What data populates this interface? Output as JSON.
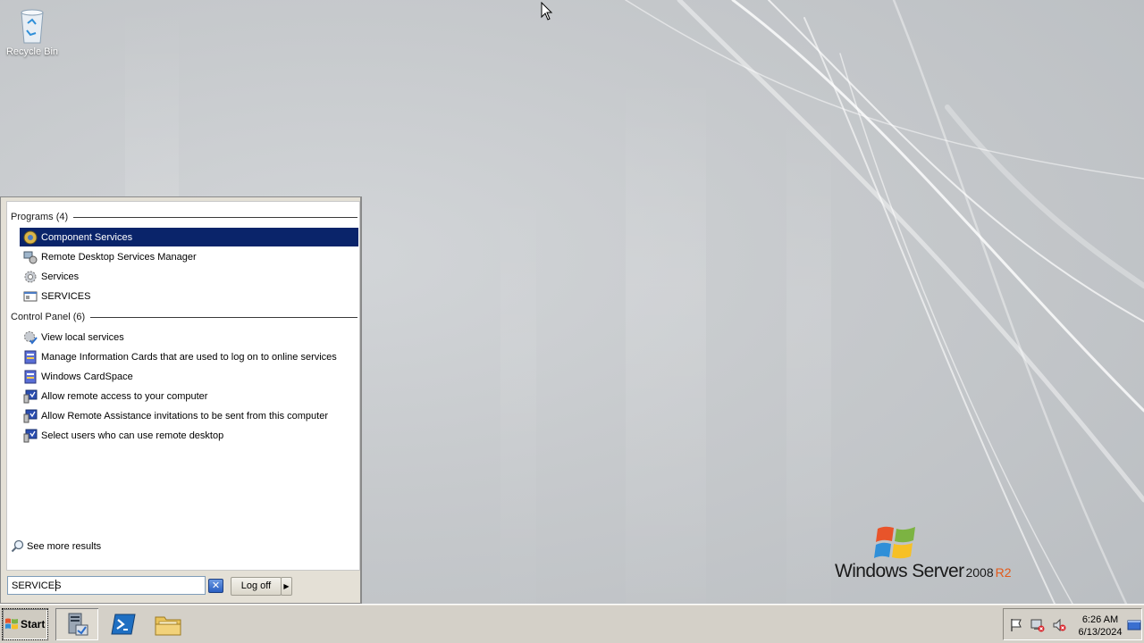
{
  "desktop": {
    "recycle_bin_label": "Recycle Bin",
    "brand": {
      "windows_server": "Windows Server",
      "year": "2008",
      "edition": "R2"
    }
  },
  "start_menu": {
    "programs_header": "Programs (4)",
    "programs": [
      {
        "label": "Component Services",
        "icon": "component-services-icon",
        "selected": true
      },
      {
        "label": "Remote Desktop Services Manager",
        "icon": "remote-desktop-manager-icon"
      },
      {
        "label": "Services",
        "icon": "services-gear-icon"
      },
      {
        "label": "SERVICES",
        "icon": "console-icon"
      }
    ],
    "control_panel_header": "Control Panel (6)",
    "control_panel": [
      {
        "label": "View local services",
        "icon": "services-check-icon"
      },
      {
        "label": "Manage Information Cards that are used to log on to online services",
        "icon": "cardspace-icon"
      },
      {
        "label": "Windows CardSpace",
        "icon": "cardspace-icon"
      },
      {
        "label": "Allow remote access to your computer",
        "icon": "system-monitor-icon"
      },
      {
        "label": "Allow Remote Assistance invitations to be sent from this computer",
        "icon": "system-monitor-icon"
      },
      {
        "label": "Select users who can use remote desktop",
        "icon": "system-monitor-icon"
      }
    ],
    "see_more": "See more results",
    "search_value": "SERVICES",
    "log_off": "Log off"
  },
  "taskbar": {
    "start_label": "Start",
    "clock_time": "6:26 AM",
    "clock_date": "6/13/2024"
  },
  "colors": {
    "selection": "#0a246a",
    "taskbar": "#d4d0c8",
    "edition_accent": "#e35a1a"
  }
}
